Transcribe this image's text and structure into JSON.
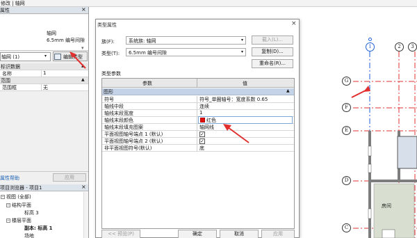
{
  "app": {
    "title_fragment": "修改 | 轴网"
  },
  "properties": {
    "title": "属性",
    "close_glyph": "×",
    "preview_name": "轴网",
    "preview_type": "6.5mm 编号间隙",
    "type_selector": "轴网 (1)",
    "edit_type_label": "编辑类型",
    "sections": [
      {
        "header": "标识数据",
        "rows": [
          {
            "key": "名称",
            "value": "1"
          }
        ]
      },
      {
        "header": "范围",
        "rows": [
          {
            "key": "范围框",
            "value": "无"
          }
        ]
      }
    ],
    "help_link": "属性帮助",
    "apply_label": "应用"
  },
  "browser": {
    "title": "项目浏览器 - 项目1",
    "close_glyph": "×",
    "nodes": [
      {
        "label": "视图 (全部)",
        "toggle": "−"
      },
      {
        "label": "结构平面",
        "toggle": "−"
      },
      {
        "label": "标高 3",
        "toggle": ""
      },
      {
        "label": "楼层平面",
        "toggle": "−"
      },
      {
        "label": "副本: 标高 1",
        "toggle": ""
      },
      {
        "label": "场地",
        "toggle": ""
      }
    ]
  },
  "dialog": {
    "title": "类型属性",
    "close_glyph": "×",
    "family_label": "族(F):",
    "family_value": "系统族: 轴网",
    "type_label": "类型(T):",
    "type_value": "6.5mm 编号间隙",
    "load_button": "载入(L)...",
    "duplicate_button": "复制(D)...",
    "rename_button": "重命名(R)...",
    "type_params_label": "类型参数",
    "col_param": "参数",
    "col_value": "值",
    "section_graphics": "图形",
    "params": [
      {
        "key": "符号",
        "value": "符号_单圈轴号：宽度系数 0.65",
        "kind": "text"
      },
      {
        "key": "轴线中段",
        "value": "连续",
        "kind": "text"
      },
      {
        "key": "轴线末段宽度",
        "value": "1",
        "kind": "text"
      },
      {
        "key": "轴线末段颜色",
        "value": "红色",
        "kind": "color",
        "color": "#e01010"
      },
      {
        "key": "轴线末段填充图案",
        "value": "轴网线",
        "kind": "text"
      },
      {
        "key": "平面视图轴号端点 1 (默认)",
        "value": "✓",
        "kind": "check"
      },
      {
        "key": "平面视图轴号端点 2 (默认)",
        "value": "✓",
        "kind": "check"
      },
      {
        "key": "非平面视图符号(默认)",
        "value": "底",
        "kind": "text"
      }
    ],
    "preview_button": "<< 预览(P)",
    "ok_button": "确定",
    "cancel_button": "取消",
    "apply_button": "应用"
  },
  "canvas": {
    "top_bubbles": [
      "1",
      "2",
      "3"
    ],
    "left_bubbles": [
      "G",
      "F",
      "E",
      "D",
      "C"
    ],
    "room_label": "房间",
    "annotation_color": "#e23030",
    "selected_grid_color": "#1f5fd6"
  }
}
